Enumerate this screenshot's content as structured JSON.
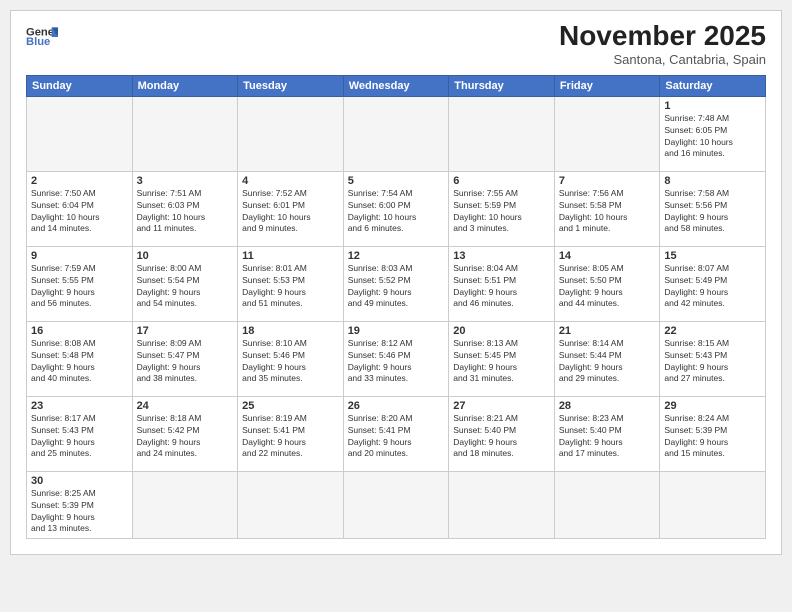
{
  "header": {
    "logo_general": "General",
    "logo_blue": "Blue",
    "month_title": "November 2025",
    "location": "Santona, Cantabria, Spain"
  },
  "days_of_week": [
    "Sunday",
    "Monday",
    "Tuesday",
    "Wednesday",
    "Thursday",
    "Friday",
    "Saturday"
  ],
  "weeks": [
    [
      {
        "num": "",
        "info": ""
      },
      {
        "num": "",
        "info": ""
      },
      {
        "num": "",
        "info": ""
      },
      {
        "num": "",
        "info": ""
      },
      {
        "num": "",
        "info": ""
      },
      {
        "num": "",
        "info": ""
      },
      {
        "num": "1",
        "info": "Sunrise: 7:48 AM\nSunset: 6:05 PM\nDaylight: 10 hours\nand 16 minutes."
      }
    ],
    [
      {
        "num": "2",
        "info": "Sunrise: 7:50 AM\nSunset: 6:04 PM\nDaylight: 10 hours\nand 14 minutes."
      },
      {
        "num": "3",
        "info": "Sunrise: 7:51 AM\nSunset: 6:03 PM\nDaylight: 10 hours\nand 11 minutes."
      },
      {
        "num": "4",
        "info": "Sunrise: 7:52 AM\nSunset: 6:01 PM\nDaylight: 10 hours\nand 9 minutes."
      },
      {
        "num": "5",
        "info": "Sunrise: 7:54 AM\nSunset: 6:00 PM\nDaylight: 10 hours\nand 6 minutes."
      },
      {
        "num": "6",
        "info": "Sunrise: 7:55 AM\nSunset: 5:59 PM\nDaylight: 10 hours\nand 3 minutes."
      },
      {
        "num": "7",
        "info": "Sunrise: 7:56 AM\nSunset: 5:58 PM\nDaylight: 10 hours\nand 1 minute."
      },
      {
        "num": "8",
        "info": "Sunrise: 7:58 AM\nSunset: 5:56 PM\nDaylight: 9 hours\nand 58 minutes."
      }
    ],
    [
      {
        "num": "9",
        "info": "Sunrise: 7:59 AM\nSunset: 5:55 PM\nDaylight: 9 hours\nand 56 minutes."
      },
      {
        "num": "10",
        "info": "Sunrise: 8:00 AM\nSunset: 5:54 PM\nDaylight: 9 hours\nand 54 minutes."
      },
      {
        "num": "11",
        "info": "Sunrise: 8:01 AM\nSunset: 5:53 PM\nDaylight: 9 hours\nand 51 minutes."
      },
      {
        "num": "12",
        "info": "Sunrise: 8:03 AM\nSunset: 5:52 PM\nDaylight: 9 hours\nand 49 minutes."
      },
      {
        "num": "13",
        "info": "Sunrise: 8:04 AM\nSunset: 5:51 PM\nDaylight: 9 hours\nand 46 minutes."
      },
      {
        "num": "14",
        "info": "Sunrise: 8:05 AM\nSunset: 5:50 PM\nDaylight: 9 hours\nand 44 minutes."
      },
      {
        "num": "15",
        "info": "Sunrise: 8:07 AM\nSunset: 5:49 PM\nDaylight: 9 hours\nand 42 minutes."
      }
    ],
    [
      {
        "num": "16",
        "info": "Sunrise: 8:08 AM\nSunset: 5:48 PM\nDaylight: 9 hours\nand 40 minutes."
      },
      {
        "num": "17",
        "info": "Sunrise: 8:09 AM\nSunset: 5:47 PM\nDaylight: 9 hours\nand 38 minutes."
      },
      {
        "num": "18",
        "info": "Sunrise: 8:10 AM\nSunset: 5:46 PM\nDaylight: 9 hours\nand 35 minutes."
      },
      {
        "num": "19",
        "info": "Sunrise: 8:12 AM\nSunset: 5:46 PM\nDaylight: 9 hours\nand 33 minutes."
      },
      {
        "num": "20",
        "info": "Sunrise: 8:13 AM\nSunset: 5:45 PM\nDaylight: 9 hours\nand 31 minutes."
      },
      {
        "num": "21",
        "info": "Sunrise: 8:14 AM\nSunset: 5:44 PM\nDaylight: 9 hours\nand 29 minutes."
      },
      {
        "num": "22",
        "info": "Sunrise: 8:15 AM\nSunset: 5:43 PM\nDaylight: 9 hours\nand 27 minutes."
      }
    ],
    [
      {
        "num": "23",
        "info": "Sunrise: 8:17 AM\nSunset: 5:43 PM\nDaylight: 9 hours\nand 25 minutes."
      },
      {
        "num": "24",
        "info": "Sunrise: 8:18 AM\nSunset: 5:42 PM\nDaylight: 9 hours\nand 24 minutes."
      },
      {
        "num": "25",
        "info": "Sunrise: 8:19 AM\nSunset: 5:41 PM\nDaylight: 9 hours\nand 22 minutes."
      },
      {
        "num": "26",
        "info": "Sunrise: 8:20 AM\nSunset: 5:41 PM\nDaylight: 9 hours\nand 20 minutes."
      },
      {
        "num": "27",
        "info": "Sunrise: 8:21 AM\nSunset: 5:40 PM\nDaylight: 9 hours\nand 18 minutes."
      },
      {
        "num": "28",
        "info": "Sunrise: 8:23 AM\nSunset: 5:40 PM\nDaylight: 9 hours\nand 17 minutes."
      },
      {
        "num": "29",
        "info": "Sunrise: 8:24 AM\nSunset: 5:39 PM\nDaylight: 9 hours\nand 15 minutes."
      }
    ],
    [
      {
        "num": "30",
        "info": "Sunrise: 8:25 AM\nSunset: 5:39 PM\nDaylight: 9 hours\nand 13 minutes."
      },
      {
        "num": "",
        "info": ""
      },
      {
        "num": "",
        "info": ""
      },
      {
        "num": "",
        "info": ""
      },
      {
        "num": "",
        "info": ""
      },
      {
        "num": "",
        "info": ""
      },
      {
        "num": "",
        "info": ""
      }
    ]
  ]
}
